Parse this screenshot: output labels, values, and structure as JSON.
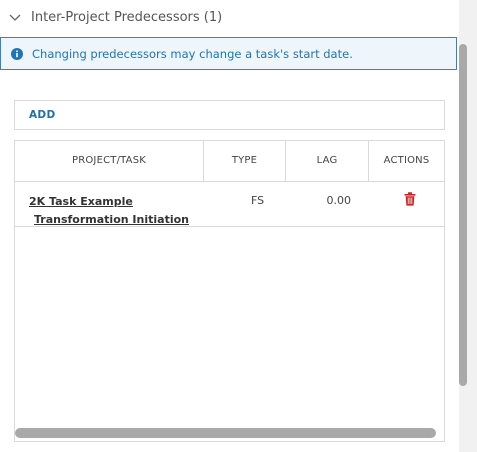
{
  "section": {
    "title": "Inter-Project Predecessors (1)"
  },
  "info": {
    "message": "Changing predecessors may change a task's start date."
  },
  "toolbar": {
    "add_label": "ADD"
  },
  "table": {
    "columns": [
      "PROJECT/TASK",
      "TYPE",
      "LAG",
      "ACTIONS"
    ],
    "rows": [
      {
        "task_line1": "2K Task Example",
        "task_line2": "Transformation Initiation",
        "type": "FS",
        "lag": "0.00"
      }
    ]
  },
  "icons": {
    "collapse": "chevron-down-icon",
    "info": "info-icon",
    "delete": "trash-icon"
  },
  "colors": {
    "accent": "#1f74b5",
    "banner_border": "#2a88c8",
    "banner_bg": "#eef6fc",
    "delete": "#c62828",
    "border": "#d9d9d9",
    "scrollbar": "#a9a9a9"
  }
}
